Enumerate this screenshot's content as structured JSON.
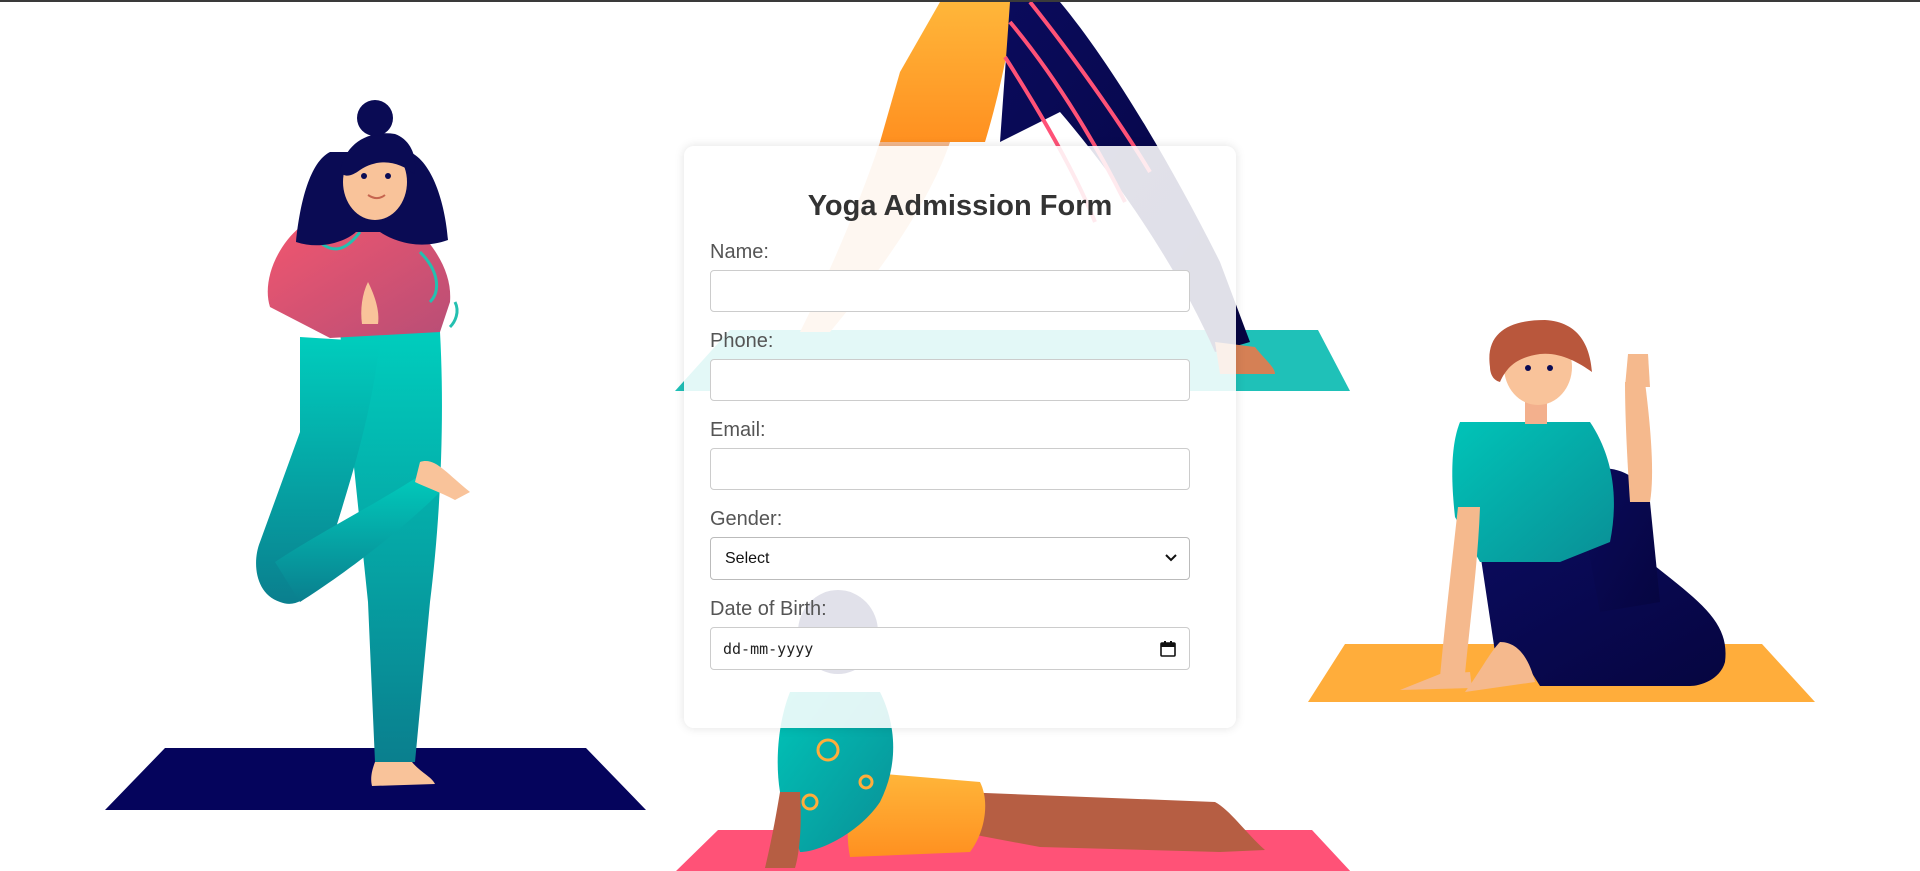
{
  "form": {
    "title": "Yoga Admission Form",
    "name_label": "Name:",
    "name_value": "",
    "phone_label": "Phone:",
    "phone_value": "",
    "email_label": "Email:",
    "email_value": "",
    "gender_label": "Gender:",
    "gender_selected": "Select",
    "dob_label": "Date of Birth:",
    "dob_placeholder": "dd-mm-yyyy"
  },
  "icons": {
    "select_arrow": "chevron-down-icon",
    "date_picker": "calendar-icon"
  },
  "colors": {
    "mat_navy": "#05045c",
    "mat_teal": "#1fc1b8",
    "mat_orange": "#ffad3b",
    "mat_pink": "#ff5277",
    "pants_teal": "#08b8ad",
    "top_pink": "#e2516e",
    "skin_light": "#f9c39a",
    "skin_dark": "#b65e43",
    "hair_navy": "#0a0b54",
    "hair_brown": "#b9573c"
  }
}
